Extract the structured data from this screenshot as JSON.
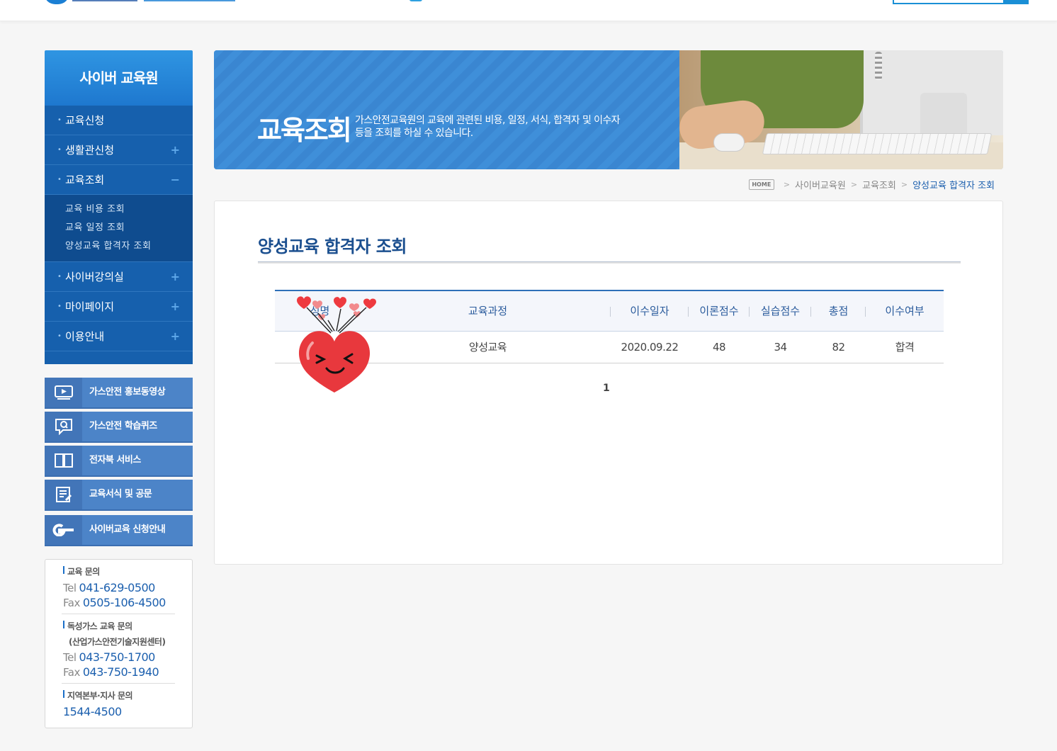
{
  "sidebar": {
    "title": "사이버 교육원",
    "menu": [
      {
        "label": "교육신청",
        "toggle": ""
      },
      {
        "label": "생활관신청",
        "toggle": "+"
      },
      {
        "label": "교육조회",
        "toggle": "−"
      }
    ],
    "submenu": [
      "교육 비용 조회",
      "교육 일정 조회",
      "양성교육 합격자 조회"
    ],
    "menu_after": [
      {
        "label": "사이버강의실",
        "toggle": "+"
      },
      {
        "label": "마이페이지",
        "toggle": "+"
      },
      {
        "label": "이용안내",
        "toggle": "+"
      }
    ],
    "quick_links": [
      {
        "label": "가스안전 홍보동영상",
        "icon": "video-icon"
      },
      {
        "label": "가스안전 학습퀴즈",
        "icon": "quiz-icon"
      },
      {
        "label": "전자북 서비스",
        "icon": "book-icon"
      },
      {
        "label": "교육서식 및 공문",
        "icon": "document-icon"
      },
      {
        "label": "사이버교육 신청안내",
        "icon": "g-logo-icon"
      }
    ],
    "contact": {
      "edu_title": "교육 문의",
      "edu_tel_key": "Tel",
      "edu_tel": "041-629-0500",
      "edu_fax_key": "Fax",
      "edu_fax": "0505-106-4500",
      "toxic_title": "독성가스 교육 문의",
      "toxic_sub": "(산업가스안전기술지원센터)",
      "toxic_tel_key": "Tel",
      "toxic_tel": "043-750-1700",
      "toxic_fax_key": "Fax",
      "toxic_fax": "043-750-1940",
      "region_title": "지역본부·지사 문의",
      "region_tel": "1544-4500"
    }
  },
  "banner": {
    "title": "교육조회",
    "description": "가스안전교육원의 교육에 관련된 비용, 일정, 서식, 합격자 및 이수자등을 조회를 하실 수 있습니다."
  },
  "breadcrumb": {
    "home": "HOME",
    "items": [
      "사이버교육원",
      "교육조회"
    ],
    "current": "양성교육 합격자 조회",
    "sep": ">"
  },
  "page": {
    "title": "양성교육 합격자 조회",
    "table": {
      "headers": [
        "성명",
        "교육과정",
        "이수일자",
        "이론점수",
        "실습점수",
        "총점",
        "이수여부"
      ],
      "rows": [
        [
          "",
          "양성교육",
          "2020.09.22",
          "48",
          "34",
          "82",
          "합격"
        ]
      ]
    },
    "pagination": {
      "current": "1"
    }
  },
  "colors": {
    "primary": "#1660ad",
    "accent": "#2e6fb8",
    "heart": "#e8383d"
  }
}
